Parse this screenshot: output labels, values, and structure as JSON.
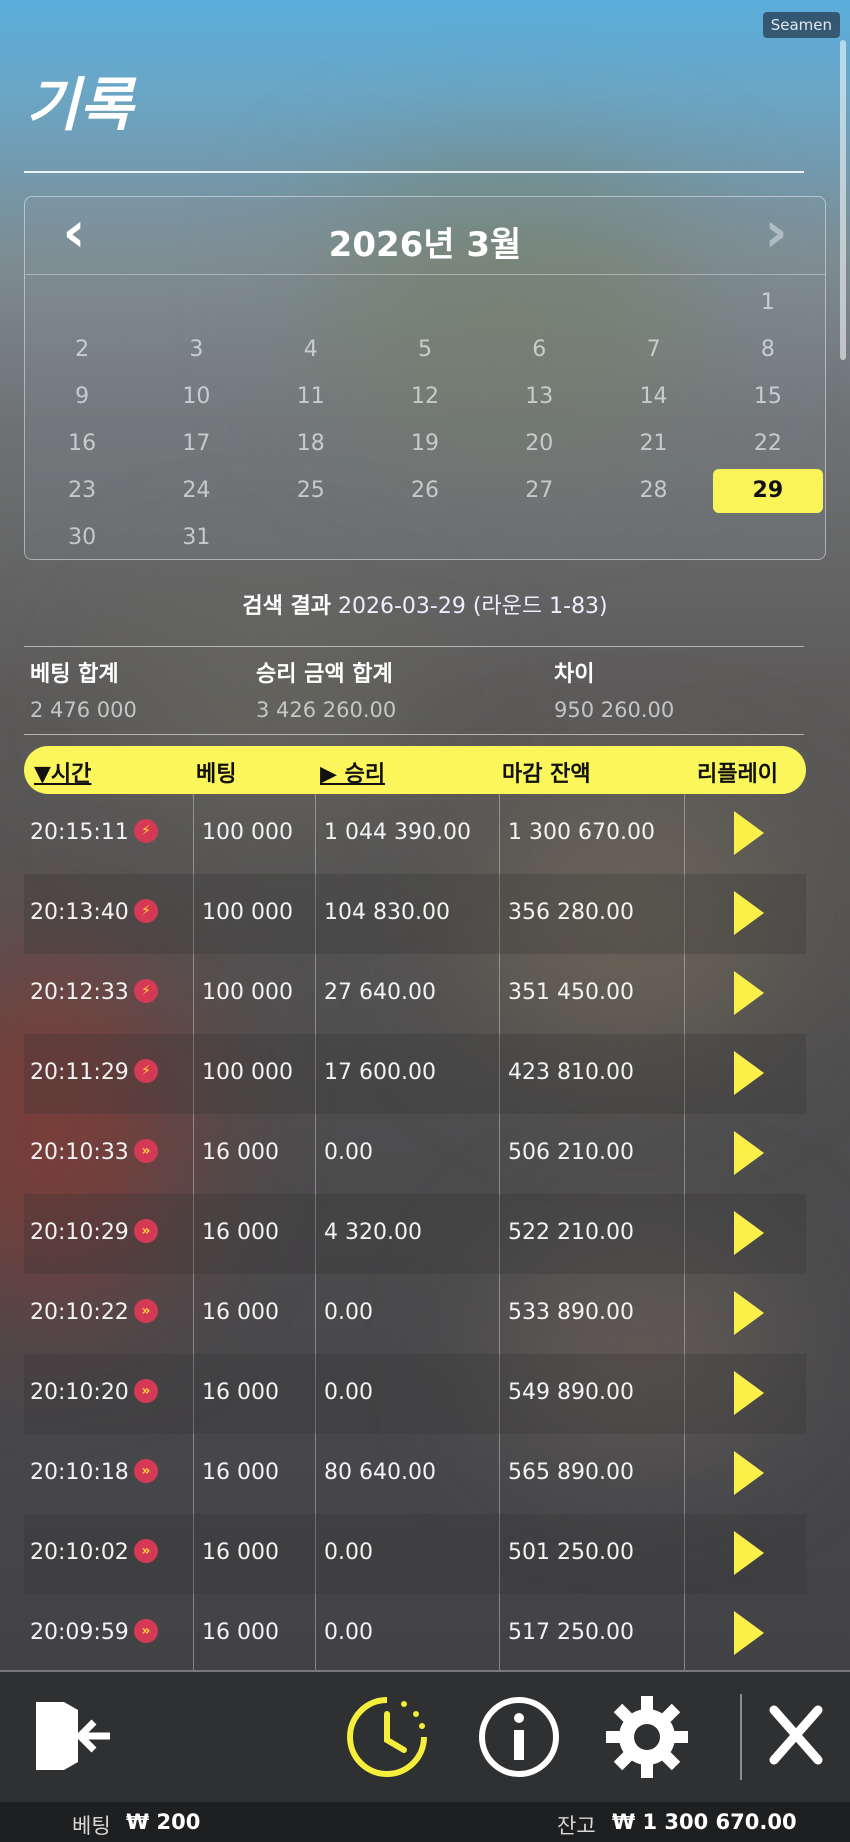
{
  "watermark": "Seamen",
  "page_title": "기록",
  "calendar": {
    "month_label": "2026년 3월",
    "prev_icon": "chevron-left-icon",
    "next_icon": "chevron-right-icon",
    "leading_blanks": 6,
    "days": [
      "1",
      "2",
      "3",
      "4",
      "5",
      "6",
      "7",
      "8",
      "9",
      "10",
      "11",
      "12",
      "13",
      "14",
      "15",
      "16",
      "17",
      "18",
      "19",
      "20",
      "21",
      "22",
      "23",
      "24",
      "25",
      "26",
      "27",
      "28",
      "29",
      "30",
      "31"
    ],
    "selected_day": "29",
    "selected_color": "#fbf35a"
  },
  "search": {
    "label": "검색 결과",
    "value": "2026-03-29 (라운드 1-83)"
  },
  "summary": {
    "bet_total_label": "베팅 합계",
    "bet_total_value": "2 476 000",
    "win_total_label": "승리 금액 합계",
    "win_total_value": "3 426 260.00",
    "diff_label": "차이",
    "diff_value": "950 260.00"
  },
  "table": {
    "header_color": "#fbf65c",
    "columns": {
      "time": "▼시간",
      "bet": "베팅",
      "win": "▶ 승리",
      "balance": "마감 잔액",
      "replay": "리플레이"
    },
    "rows": [
      {
        "time": "20:15:11",
        "icon": "lightning-icon",
        "bet": "100 000",
        "win": "1 044 390.00",
        "balance": "1 300 670.00"
      },
      {
        "time": "20:13:40",
        "icon": "lightning-icon",
        "bet": "100 000",
        "win": "104 830.00",
        "balance": "356 280.00"
      },
      {
        "time": "20:12:33",
        "icon": "lightning-icon",
        "bet": "100 000",
        "win": "27 640.00",
        "balance": "351 450.00"
      },
      {
        "time": "20:11:29",
        "icon": "lightning-icon",
        "bet": "100 000",
        "win": "17 600.00",
        "balance": "423 810.00"
      },
      {
        "time": "20:10:33",
        "icon": "fast-forward-icon",
        "bet": "16 000",
        "win": "0.00",
        "balance": "506 210.00"
      },
      {
        "time": "20:10:29",
        "icon": "fast-forward-icon",
        "bet": "16 000",
        "win": "4 320.00",
        "balance": "522 210.00"
      },
      {
        "time": "20:10:22",
        "icon": "fast-forward-icon",
        "bet": "16 000",
        "win": "0.00",
        "balance": "533 890.00"
      },
      {
        "time": "20:10:20",
        "icon": "fast-forward-icon",
        "bet": "16 000",
        "win": "0.00",
        "balance": "549 890.00"
      },
      {
        "time": "20:10:18",
        "icon": "fast-forward-icon",
        "bet": "16 000",
        "win": "80 640.00",
        "balance": "565 890.00"
      },
      {
        "time": "20:10:02",
        "icon": "fast-forward-icon",
        "bet": "16 000",
        "win": "0.00",
        "balance": "501 250.00"
      },
      {
        "time": "20:09:59",
        "icon": "fast-forward-icon",
        "bet": "16 000",
        "win": "0.00",
        "balance": "517 250.00"
      }
    ]
  },
  "toolbar": {
    "exit_icon": "exit-door-icon",
    "history_icon": "history-clock-icon",
    "info_icon": "info-icon",
    "settings_icon": "gear-icon",
    "close_icon": "close-icon",
    "active_color": "#f5ee3a"
  },
  "status": {
    "bet_label": "베팅",
    "bet_value": "₩ 200",
    "balance_label": "잔고",
    "balance_value": "₩ 1 300 670.00"
  }
}
